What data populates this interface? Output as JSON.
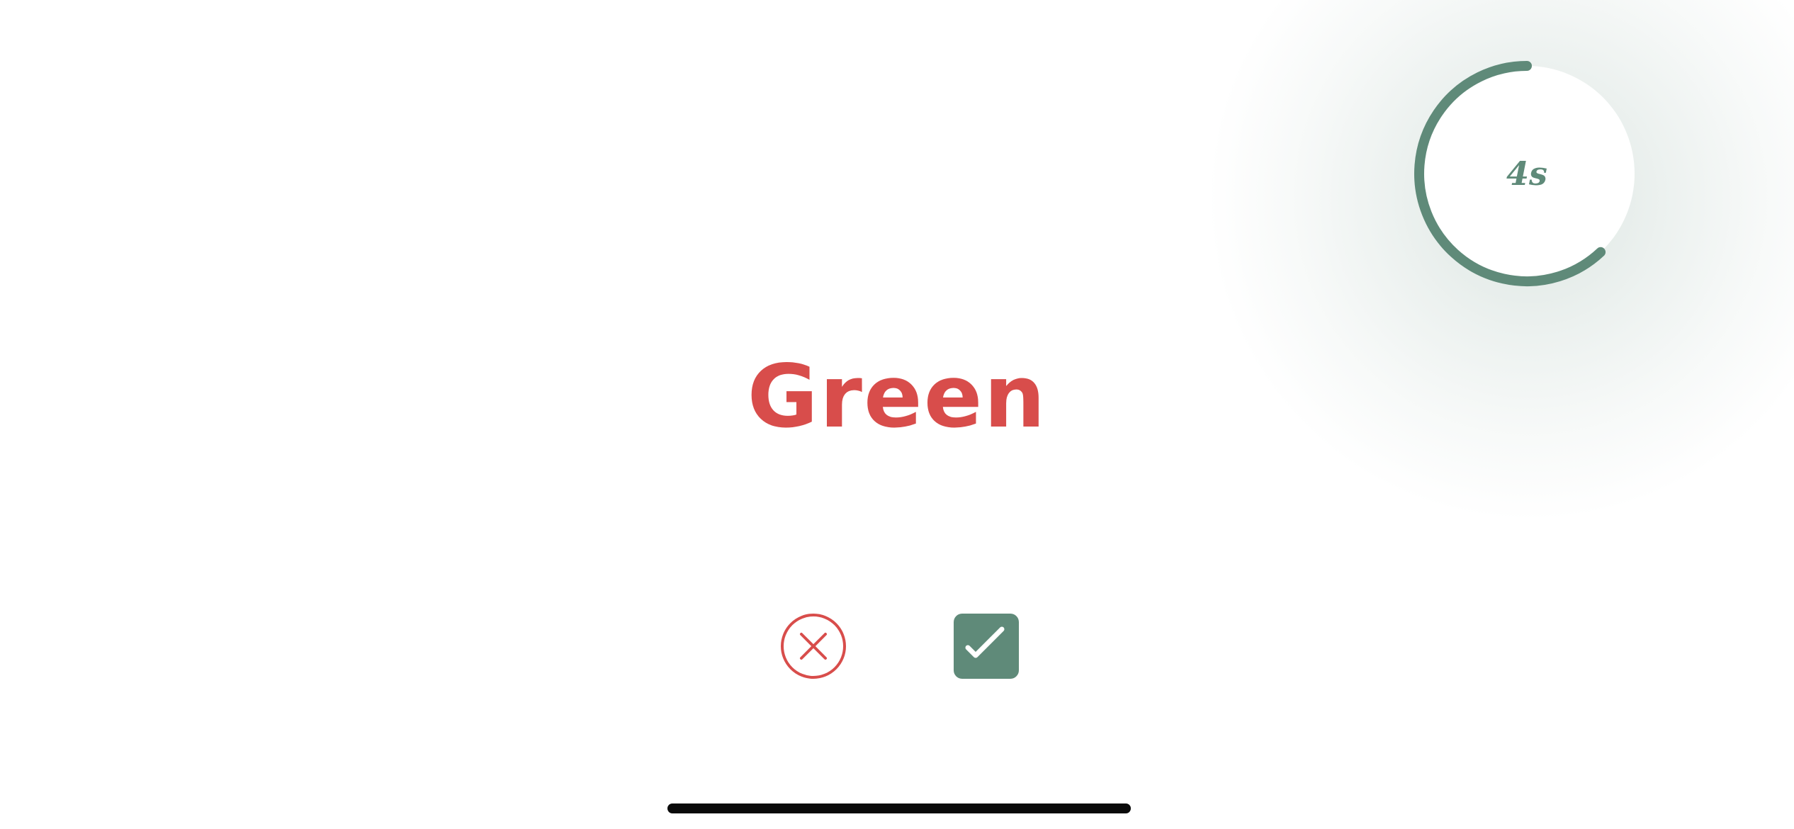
{
  "timer": {
    "label": "4s",
    "progress_fraction": 0.62,
    "color": "#5f8a79"
  },
  "prompt": {
    "word": "Green",
    "ink_color": "#d84d4b"
  },
  "actions": {
    "reject": {
      "icon": "close-circle-icon",
      "color": "#d84d4b"
    },
    "accept": {
      "icon": "checkmark-icon",
      "color": "#5f8a79"
    }
  }
}
